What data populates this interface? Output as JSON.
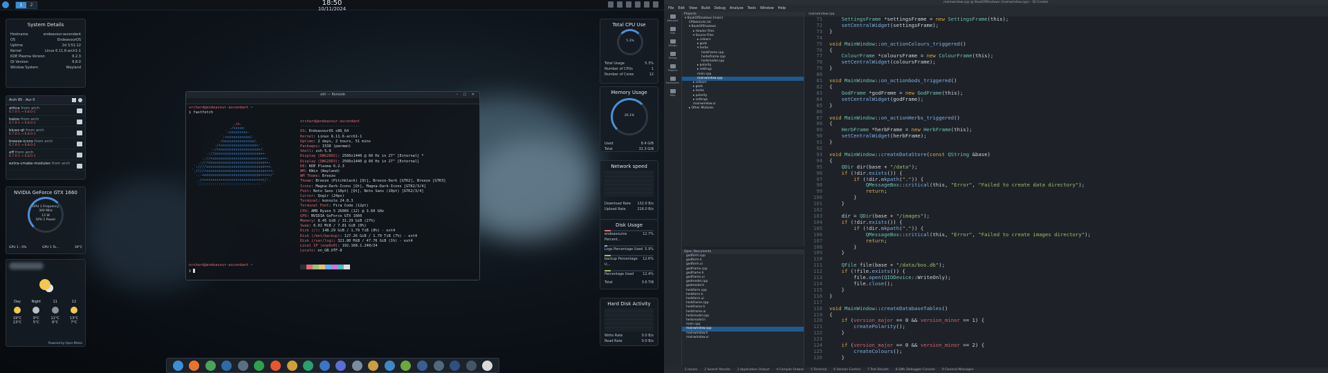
{
  "topbar": {
    "time": "18:50",
    "date": "10/11/2024",
    "pager": [
      "1",
      "2"
    ]
  },
  "system_details": {
    "title": "System Details",
    "rows": [
      [
        "Hostname",
        "endeavour-ascendant"
      ],
      [
        "OS",
        "EndeavourOS"
      ],
      [
        "Uptime",
        "2d 3:51:12"
      ],
      [
        "Kernel",
        "Linux 6.11.6-arch1-1"
      ],
      [
        "KDE Plasma Version",
        "6.2.3"
      ],
      [
        "Qt Version",
        "6.8.0"
      ],
      [
        "Window System",
        "Wayland"
      ]
    ]
  },
  "updates": {
    "header": "Arch 85 · Aur 0",
    "items": [
      {
        "name": "attica",
        "source": "from arch",
        "version": "6.7.0-1 → 6.8.0-1"
      },
      {
        "name": "baloo",
        "source": "from arch",
        "version": "6.7.0-1 → 6.8.0-1"
      },
      {
        "name": "bluez-qt",
        "source": "from arch",
        "version": "6.7.0-1 → 6.8.0-1"
      },
      {
        "name": "breeze-icons",
        "source": "from arch",
        "version": "6.7.0-1 → 6.8.0-1"
      },
      {
        "name": "eff",
        "source": "from arch",
        "version": "6.7.0-1 → 6.8.0-1"
      },
      {
        "name": "extra-cmake-modules",
        "source": "from arch",
        "version": ""
      }
    ]
  },
  "gpu": {
    "title": "NVIDIA GeForce GTX 1660",
    "gauge_lines": [
      "GPU 1 Frequency",
      "300 MHz",
      "13 W",
      "GPU 1 Power"
    ],
    "footer_left": "GPU 1 - 0%",
    "footer_mid": "GPU 1 Te...",
    "footer_right": "39°C"
  },
  "weather": {
    "days": [
      {
        "label": "Day",
        "hi": "19°C",
        "lo": "13°C"
      },
      {
        "label": "Night",
        "hi": "9°C",
        "lo": "5°C"
      },
      {
        "label": "11",
        "hi": "11°C",
        "lo": "6°C"
      },
      {
        "label": "12",
        "hi": "13°C",
        "lo": "7°C"
      }
    ],
    "footer": "Powered by Open-Meteo"
  },
  "terminal": {
    "title": "zsh — Konsole",
    "prompt_user": "orchard@endeavour-ascendant",
    "command": "fastfetch",
    "header": "orchard@endeavour-ascendant",
    "lines": [
      [
        "OS",
        "EndeavourOS x86_64"
      ],
      [
        "Kernel",
        "Linux 6.11.6-arch1-1"
      ],
      [
        "Uptime",
        "2 days, 2 hours, 51 mins"
      ],
      [
        "Packages",
        "1538 (pacman)"
      ],
      [
        "Shell",
        "zsh 5.9"
      ],
      [
        "Display (DWG2802)",
        "2560x1440 @ 60 Hz in 27\" [External] *"
      ],
      [
        "Display (DWG2803)",
        "2560x1440 @ 60 Hz in 27\" [External]"
      ],
      [
        "DE",
        "KDE Plasma 6.2.3"
      ],
      [
        "WM",
        "KWin (Wayland)"
      ],
      [
        "WM Theme",
        "Breeze"
      ],
      [
        "Theme",
        "Breeze (Pitchblack) [Qt], Breeze-Dark [GTK2], Breeze [GTK3]"
      ],
      [
        "Icons",
        "Magna-Dark-Icons [Qt], Magna-Dark-Icons [GTK2/3/4]"
      ],
      [
        "Font",
        "Noto Sans (10pt) [Qt], Noto Sans (10pt) [GTK2/3/4]"
      ],
      [
        "Cursor",
        "Qogir (24px)"
      ],
      [
        "Terminal",
        "konsole 24.8.3"
      ],
      [
        "Terminal Font",
        "Fira Code (12pt)"
      ],
      [
        "CPU",
        "AMD Ryzen 5 2600X (12) @ 3.60 GHz"
      ],
      [
        "GPU",
        "NVIDIA GeForce GTX 1660"
      ],
      [
        "Memory",
        "8.45 GiB / 31.29 GiB (27%)"
      ],
      [
        "Swap",
        "6.02 MiB / 7.81 GiB (0%)"
      ],
      [
        "Disk (/)",
        "148.29 GiB / 1.79 TiB (8%) - ext4"
      ],
      [
        "Disk (/mnt/backup)",
        "127.26 GiB / 1.79 TiB (7%) - ext4"
      ],
      [
        "Disk (/var/log)",
        "321.80 MiB / 47.76 GiB (1%) - ext4"
      ],
      [
        "Local IP (enp6s0)",
        "192.168.1.240/24"
      ],
      [
        "Locale",
        "en_GB.UTF-8"
      ]
    ]
  },
  "cpu": {
    "title": "Total CPU Use",
    "gauge": "5.3%",
    "rows": [
      [
        "Total Usage",
        "5.3%"
      ],
      [
        "Number of CPUs",
        "1"
      ],
      [
        "Number of Cores",
        "12"
      ]
    ],
    "percent": 5.3
  },
  "memory": {
    "title": "Memory Usage",
    "gauge": "26.1%",
    "rows": [
      [
        "Used",
        "8.4 GiB"
      ],
      [
        "Total",
        "31.3 GiB"
      ]
    ],
    "percent": 26.1
  },
  "network": {
    "title": "Network speed",
    "rows": [
      [
        "Download Rate",
        "132.0 B/s"
      ],
      [
        "Upload Rate",
        "216.0 B/s"
      ]
    ]
  },
  "disk": {
    "title": "Disk Usage",
    "rows": [
      {
        "label": "endeavouros Percent...",
        "value": "12.7%",
        "pct": 12.7,
        "color": "#e06c75"
      },
      {
        "label": "Logs Percentage Used",
        "value": "5.9%",
        "pct": 5.9,
        "color": "#7fb0e8"
      },
      {
        "label": "backup Percentage U...",
        "value": "12.6%",
        "pct": 12.6,
        "color": "#9fbf6a"
      },
      {
        "label": "Percentage Used",
        "value": "12.4%",
        "pct": 12.4,
        "color": "#9fbf6a"
      },
      {
        "label": "Total",
        "value": "3.6 TiB",
        "pct": 0,
        "color": "#9fbf6a"
      }
    ]
  },
  "hdd": {
    "title": "Hard Disk Activity",
    "rows": [
      [
        "Write Rate",
        "0.0 B/s"
      ],
      [
        "Read Rate",
        "0.0 B/s"
      ]
    ]
  },
  "ide": {
    "title": "mainwindow.cpp @ BookOfShadows (mainwindow.cpp) - Qt Creator",
    "menu": [
      "File",
      "Edit",
      "View",
      "Build",
      "Debug",
      "Analyze",
      "Tools",
      "Window",
      "Help"
    ],
    "side": [
      "Welcome",
      "Edit",
      "Design",
      "Debug",
      "Projects",
      "Extensions",
      "Help"
    ],
    "projects_label": "Projects",
    "tree": [
      {
        "text": "▾ BookOfShadows [main]",
        "d": 0
      },
      {
        "text": "CMakeLists.txt",
        "d": 1
      },
      {
        "text": "▾ BookOfShadows",
        "d": 1
      },
      {
        "text": "▸ Header Files",
        "d": 2
      },
      {
        "text": "▾ Source Files",
        "d": 2
      },
      {
        "text": "▸ colours",
        "d": 3
      },
      {
        "text": "▸ gods",
        "d": 3
      },
      {
        "text": "▾ herbs",
        "d": 3
      },
      {
        "text": "herbframe.cpp",
        "d": 4
      },
      {
        "text": "herbsframe.cpp",
        "d": 4
      },
      {
        "text": "herbmodel.cpp",
        "d": 4
      },
      {
        "text": "▸ polarity",
        "d": 3
      },
      {
        "text": "▸ settings",
        "d": 3
      },
      {
        "text": "main.cpp",
        "d": 3
      },
      {
        "text": "mainwindow.cpp",
        "d": 3,
        "sel": true
      },
      {
        "text": "▸ colours",
        "d": 2
      },
      {
        "text": "▸ gods",
        "d": 2
      },
      {
        "text": "▸ herbs",
        "d": 2
      },
      {
        "text": "▸ polarity",
        "d": 2
      },
      {
        "text": "▸ settings",
        "d": 2
      },
      {
        "text": "mainwindow.ui",
        "d": 2
      },
      {
        "text": "▸ Other Modules",
        "d": 1
      }
    ],
    "open_docs_label": "Open Documents",
    "open_docs": [
      "godform.cpp",
      "godform.h",
      "godform.ui",
      "godframe.cpp",
      "godframe.h",
      "godframe.ui",
      "godmodel.cpp",
      "godmodel.h",
      "herbform.cpp",
      "herbform.h",
      "herbform.ui",
      "herbframe.cpp",
      "herbframe.h",
      "herbframe.ui",
      "herbmodel.cpp",
      "herbmodel.h",
      "main.cpp",
      "mainwindow.cpp",
      "mainwindow.h",
      "mainwindow.ui"
    ],
    "open_docs_selected": 17,
    "editor_tab": "mainwindow.cpp",
    "code": [
      [
        "71",
        "    SettingsFrame *settingsFrame = new SettingsFrame(this);"
      ],
      [
        "72",
        "    setCentralWidget(settingsFrame);"
      ],
      [
        "73",
        "}"
      ],
      [
        "74",
        ""
      ],
      [
        "75",
        "void MainWindow::on_actionColours_triggered()"
      ],
      [
        "76",
        "{"
      ],
      [
        "77",
        "    ColourFrame *coloursFrame = new ColourFrame(this);"
      ],
      [
        "78",
        "    setCentralWidget(coloursFrame);"
      ],
      [
        "79",
        "}"
      ],
      [
        "80",
        ""
      ],
      [
        "81",
        "void MainWindow::on_actionGods_triggered()"
      ],
      [
        "82",
        "{"
      ],
      [
        "83",
        "    GodFrame *godFrame = new GodFrame(this);"
      ],
      [
        "84",
        "    setCentralWidget(godFrame);"
      ],
      [
        "85",
        "}"
      ],
      [
        "86",
        ""
      ],
      [
        "87",
        "void MainWindow::on_actionHerbs_triggered()"
      ],
      [
        "88",
        "{"
      ],
      [
        "89",
        "    HerbFrame *herbFrame = new HerbFrame(this);"
      ],
      [
        "90",
        "    setCentralWidget(herbFrame);"
      ],
      [
        "91",
        "}"
      ],
      [
        "92",
        ""
      ],
      [
        "93",
        "void MainWindow::createDataStore(const QString &base)"
      ],
      [
        "94",
        "{"
      ],
      [
        "95",
        "    QDir dir(base + \"/data\");"
      ],
      [
        "96",
        "    if (!dir.exists()) {"
      ],
      [
        "97",
        "        if (!dir.mkpath(\".\")) {"
      ],
      [
        "98",
        "            QMessageBox::critical(this, \"Error\", \"Failed to create data directory\");"
      ],
      [
        "99",
        "            return;"
      ],
      [
        "100",
        "        }"
      ],
      [
        "101",
        "    }"
      ],
      [
        "102",
        ""
      ],
      [
        "103",
        "    dir = QDir(base + \"/images\");"
      ],
      [
        "104",
        "    if (!dir.exists()) {"
      ],
      [
        "105",
        "        if (!dir.mkpath(\".\")) {"
      ],
      [
        "106",
        "            QMessageBox::critical(this, \"Error\", \"Failed to create images directory\");"
      ],
      [
        "107",
        "            return;"
      ],
      [
        "108",
        "        }"
      ],
      [
        "109",
        "    }"
      ],
      [
        "110",
        ""
      ],
      [
        "111",
        "    QFile file(base + \"/data/bos.db\");"
      ],
      [
        "112",
        "    if (!file.exists()) {"
      ],
      [
        "113",
        "        file.open(QIODevice::WriteOnly);"
      ],
      [
        "114",
        "        file.close();"
      ],
      [
        "115",
        "    }"
      ],
      [
        "116",
        "}"
      ],
      [
        "117",
        ""
      ],
      [
        "118",
        "void MainWindow::createDatabaseTables()"
      ],
      [
        "119",
        "{"
      ],
      [
        "120",
        "    if (version_major == 0 && version_minor == 1) {"
      ],
      [
        "121",
        "        createPolarity();"
      ],
      [
        "122",
        "    }"
      ],
      [
        "123",
        ""
      ],
      [
        "124",
        "    if (version_major == 0 && version_minor == 2) {"
      ],
      [
        "125",
        "        createColours();"
      ],
      [
        "126",
        "    }"
      ]
    ],
    "status": [
      "1 Issues",
      "2 Search Results",
      "3 Application Output",
      "4 Compile Output",
      "5 Terminal",
      "6 Version Control",
      "7 Test Results",
      "8 QML Debugger Console",
      "9 General Messages"
    ]
  }
}
